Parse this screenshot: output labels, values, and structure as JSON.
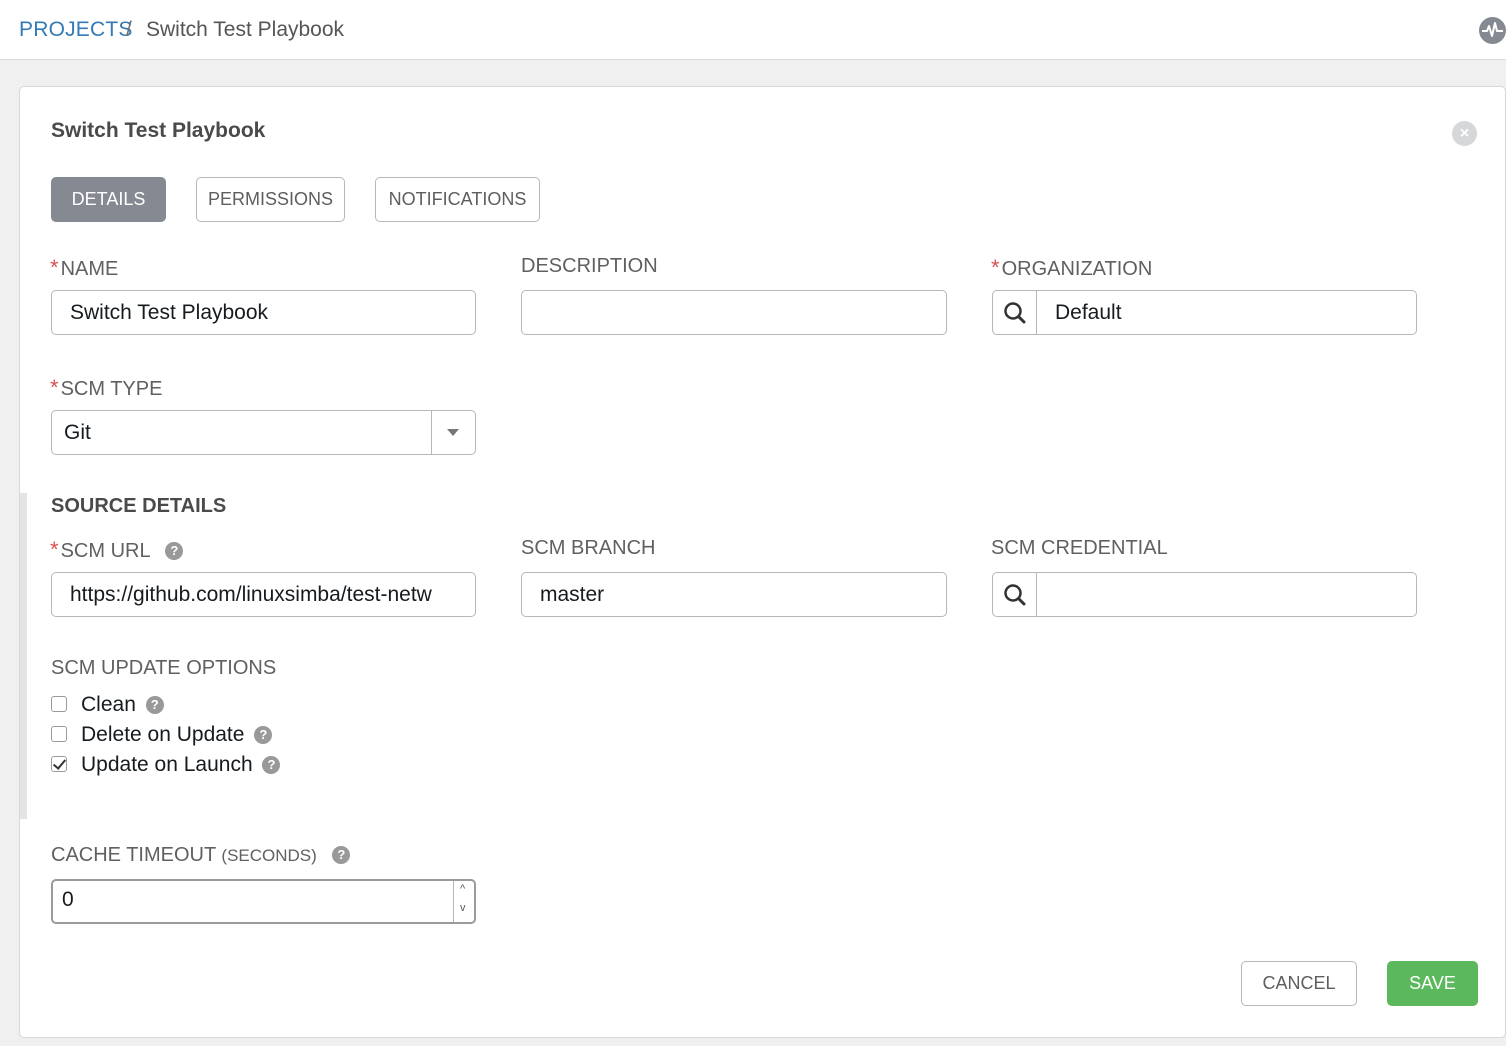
{
  "breadcrumb": {
    "parent": "PROJECTS",
    "separator": "/",
    "current": "Switch Test Playbook"
  },
  "form": {
    "title": "Switch Test Playbook",
    "tabs": [
      {
        "label": "DETAILS",
        "active": true
      },
      {
        "label": "PERMISSIONS",
        "active": false
      },
      {
        "label": "NOTIFICATIONS",
        "active": false
      }
    ],
    "name": {
      "label": "NAME",
      "value": "Switch Test Playbook",
      "required": true
    },
    "description": {
      "label": "DESCRIPTION",
      "value": ""
    },
    "organization": {
      "label": "ORGANIZATION",
      "value": "Default",
      "required": true
    },
    "scm_type": {
      "label": "SCM TYPE",
      "value": "Git",
      "required": true
    },
    "source_details": {
      "title": "SOURCE DETAILS",
      "scm_url": {
        "label": "SCM URL",
        "value": "https://github.com/linuxsimba/test-netw",
        "required": true
      },
      "scm_branch": {
        "label": "SCM BRANCH",
        "value": "master"
      },
      "scm_credential": {
        "label": "SCM CREDENTIAL",
        "value": ""
      },
      "update_options": {
        "label": "SCM UPDATE OPTIONS",
        "items": [
          {
            "label": "Clean",
            "checked": false
          },
          {
            "label": "Delete on Update",
            "checked": false
          },
          {
            "label": "Update on Launch",
            "checked": true
          }
        ]
      }
    },
    "cache_timeout": {
      "label": "CACHE TIMEOUT",
      "unit": "(SECONDS)",
      "value": "0"
    },
    "buttons": {
      "cancel": "CANCEL",
      "save": "SAVE"
    }
  },
  "icons": {
    "help": "?",
    "close": "×",
    "up": "^",
    "down": "v"
  },
  "colors": {
    "link": "#337ab7",
    "active_tab": "#848992",
    "required": "#d9534f",
    "save": "#5cb85c"
  }
}
